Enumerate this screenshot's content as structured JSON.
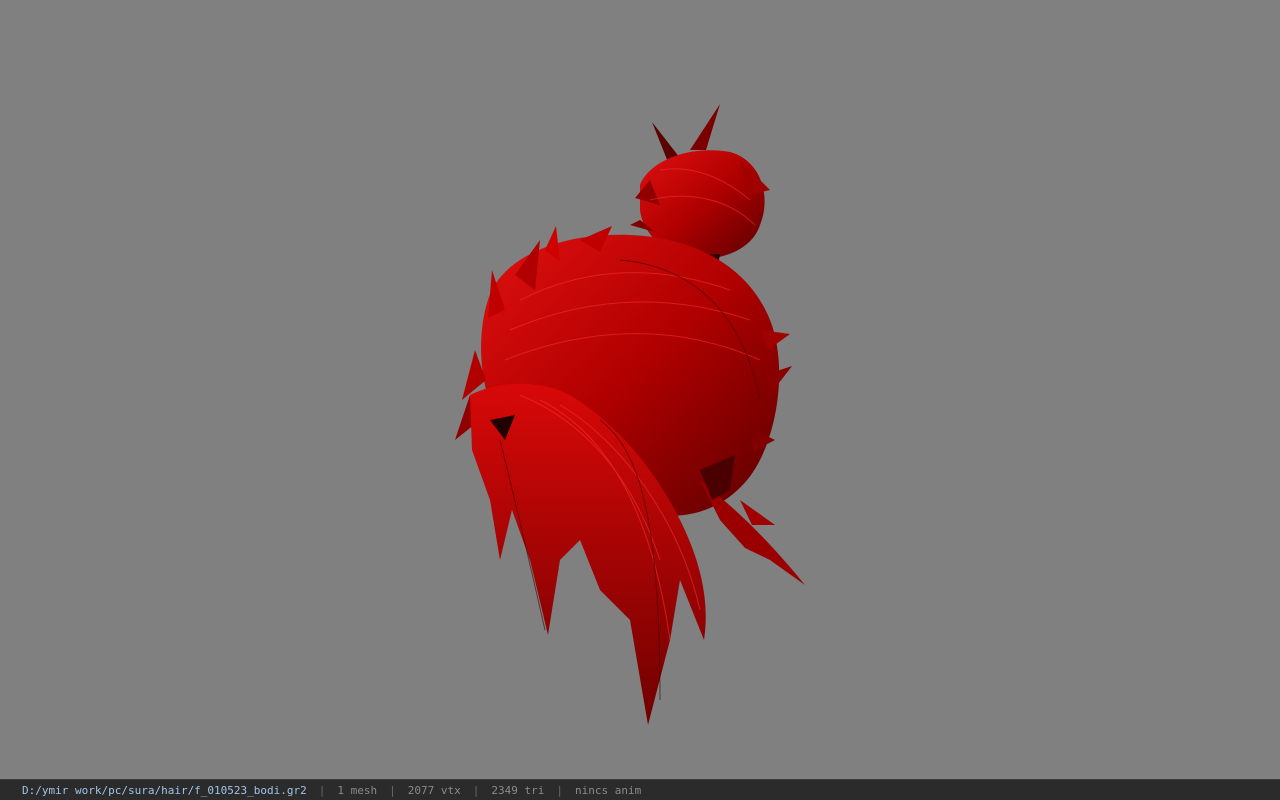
{
  "viewport": {
    "background": "#808080",
    "model_color": "#c00000",
    "model_name": "hair-model"
  },
  "statusbar": {
    "file_path": "D:/ymir work/pc/sura/hair/f_010523_bodi.gr2",
    "separator": "|",
    "mesh_count": "1 mesh",
    "vertex_count": "2077 vtx",
    "triangle_count": "2349 tri",
    "anim_status": "nincs anim"
  }
}
